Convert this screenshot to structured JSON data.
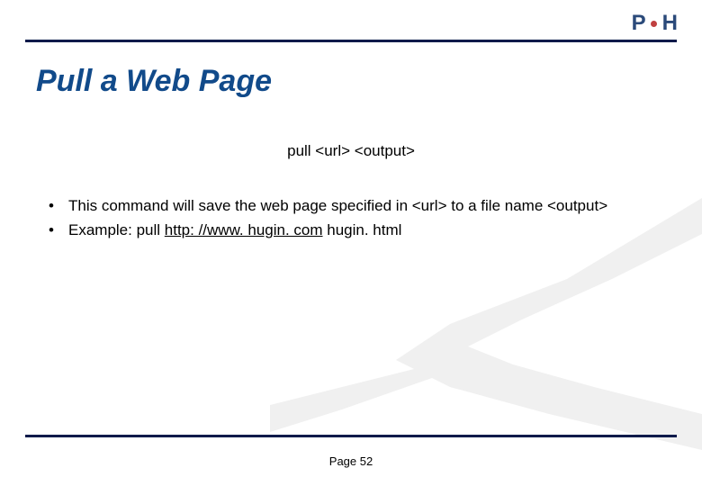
{
  "logo": {
    "letter1": "P",
    "letter2": "H"
  },
  "title": "Pull a Web Page",
  "command": "pull <url> <output>",
  "bullets": [
    {
      "pre": "This command will save the web page specified in <url> to a file name <output>",
      "link": "",
      "post": ""
    },
    {
      "pre": "Example: pull ",
      "link": "http: //www. hugin. com",
      "post": " hugin. html"
    }
  ],
  "footer": "Page 52"
}
